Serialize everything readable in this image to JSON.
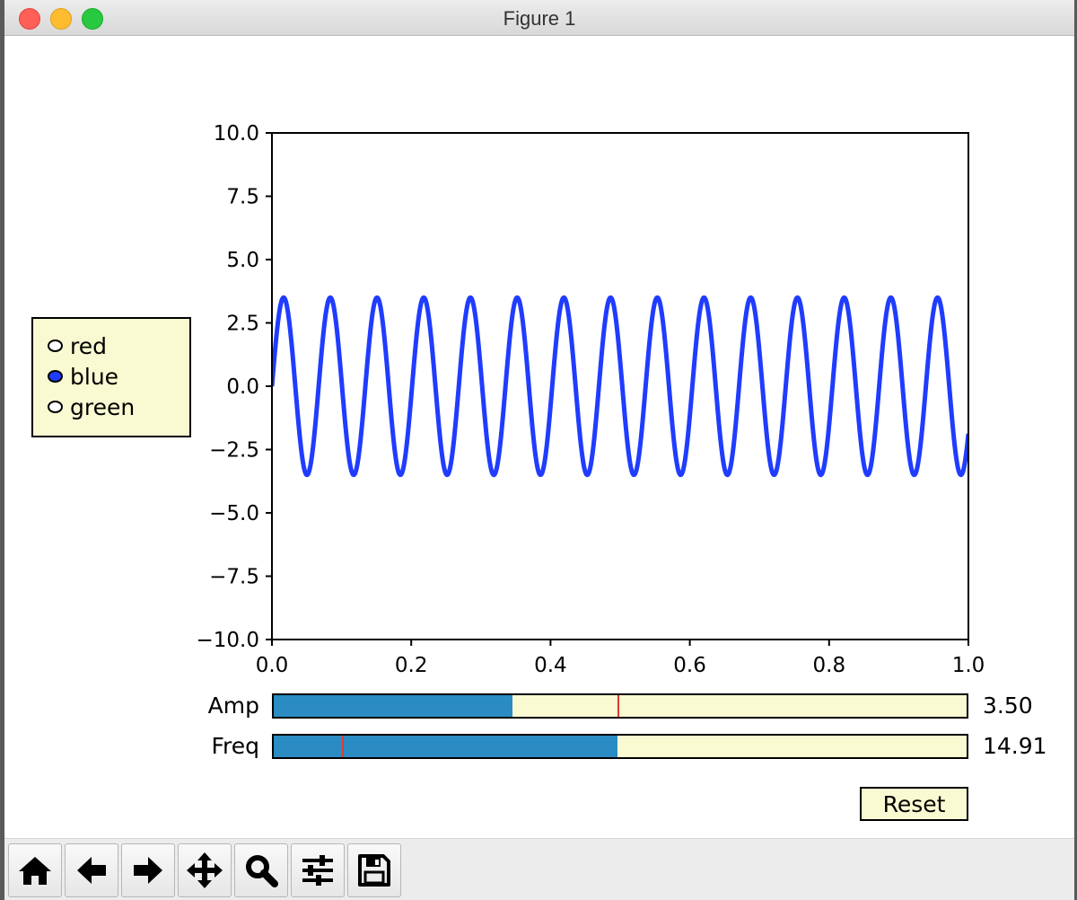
{
  "window": {
    "title": "Figure 1"
  },
  "plot": {
    "type": "line",
    "series_color": "#1f3cff",
    "amplitude": 3.5,
    "frequency": 14.91,
    "xlim": [
      0.0,
      1.0
    ],
    "ylim": [
      -10.0,
      10.0
    ],
    "x_ticks": [
      "0.0",
      "0.2",
      "0.4",
      "0.6",
      "0.8",
      "1.0"
    ],
    "y_ticks": [
      "10.0",
      "7.5",
      "5.0",
      "2.5",
      "0.0",
      "−2.5",
      "−5.0",
      "−7.5",
      "−10.0"
    ]
  },
  "chart_data": {
    "type": "line",
    "function": "y = 3.5 * sin(2 * pi * 14.91 * x)",
    "x_range": [
      0.0,
      1.0
    ],
    "amplitude": 3.5,
    "frequency": 14.91,
    "ylim": [
      -10.0,
      10.0
    ],
    "xlim": [
      0.0,
      1.0
    ],
    "series": [
      {
        "color": "#1f3cff"
      }
    ]
  },
  "radio": {
    "options": [
      {
        "label": "red",
        "selected": false
      },
      {
        "label": "blue",
        "selected": true
      },
      {
        "label": "green",
        "selected": false
      }
    ]
  },
  "sliders": {
    "amp": {
      "label": "Amp",
      "value_text": "3.50",
      "fill_fraction": 0.344,
      "init_fraction": 0.496
    },
    "freq": {
      "label": "Freq",
      "value_text": "14.91",
      "fill_fraction": 0.496,
      "init_fraction": 0.098
    }
  },
  "reset": {
    "label": "Reset"
  },
  "colors": {
    "slider_fill": "#2b8cc4",
    "widget_bg": "#fafad2",
    "slider_init_marker": "#e03a2f"
  },
  "toolbar": {
    "tools": [
      "home-icon",
      "back-arrow-icon",
      "forward-arrow-icon",
      "pan-move-icon",
      "zoom-magnifier-icon",
      "configure-subplots-icon",
      "save-floppy-icon"
    ]
  }
}
